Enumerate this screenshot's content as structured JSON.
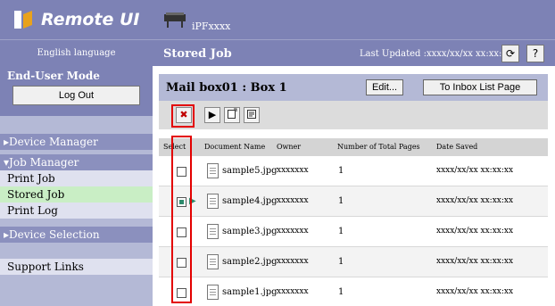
{
  "sidebar": {
    "logo_text": "Remote UI",
    "language": "English language",
    "mode_label": "End-User Mode",
    "logout_label": "Log Out",
    "device_manager": "Device Manager",
    "job_manager": "Job Manager",
    "items": [
      "Print Job",
      "Stored Job",
      "Print Log"
    ],
    "device_selection": "Device Selection",
    "support_links": "Support Links"
  },
  "header": {
    "printer_name": "iPFxxxx",
    "page_title": "Stored Job",
    "last_updated": "Last Updated :xxxx/xx/xx xx:xx:xx",
    "refresh_icon": "refresh-icon",
    "help_label": "?"
  },
  "panel": {
    "mailbox_title": "Mail box01 : Box 1",
    "edit_label": "Edit...",
    "inbox_label": "To Inbox List Page"
  },
  "toolbar": {
    "delete_label": "✖",
    "print_label": "▶",
    "move_icon": "move-icon",
    "properties_icon": "properties-icon"
  },
  "table": {
    "headers": [
      "Select",
      "Document Name",
      "Owner",
      "Number of Total Pages",
      "Date Saved"
    ],
    "rows": [
      {
        "name": "sample5.jpg",
        "owner": "xxxxxxx",
        "pages": "1",
        "date": "xxxx/xx/xx xx:xx:xx",
        "checked": false
      },
      {
        "name": "sample4.jpg",
        "owner": "xxxxxxx",
        "pages": "1",
        "date": "xxxx/xx/xx xx:xx:xx",
        "checked": true
      },
      {
        "name": "sample3.jpg",
        "owner": "xxxxxxx",
        "pages": "1",
        "date": "xxxx/xx/xx xx:xx:xx",
        "checked": false
      },
      {
        "name": "sample2.jpg",
        "owner": "xxxxxxx",
        "pages": "1",
        "date": "xxxx/xx/xx xx:xx:xx",
        "checked": false
      },
      {
        "name": "sample1.jpg",
        "owner": "xxxxxxx",
        "pages": "1",
        "date": "xxxx/xx/xx xx:xx:xx",
        "checked": false
      }
    ]
  },
  "colors": {
    "sidebar_bg": "#b4b9d6",
    "header_bg": "#7d82b5",
    "active_item": "#c9eec5",
    "highlight": "#e30000",
    "check_color": "#2c8a6c"
  }
}
